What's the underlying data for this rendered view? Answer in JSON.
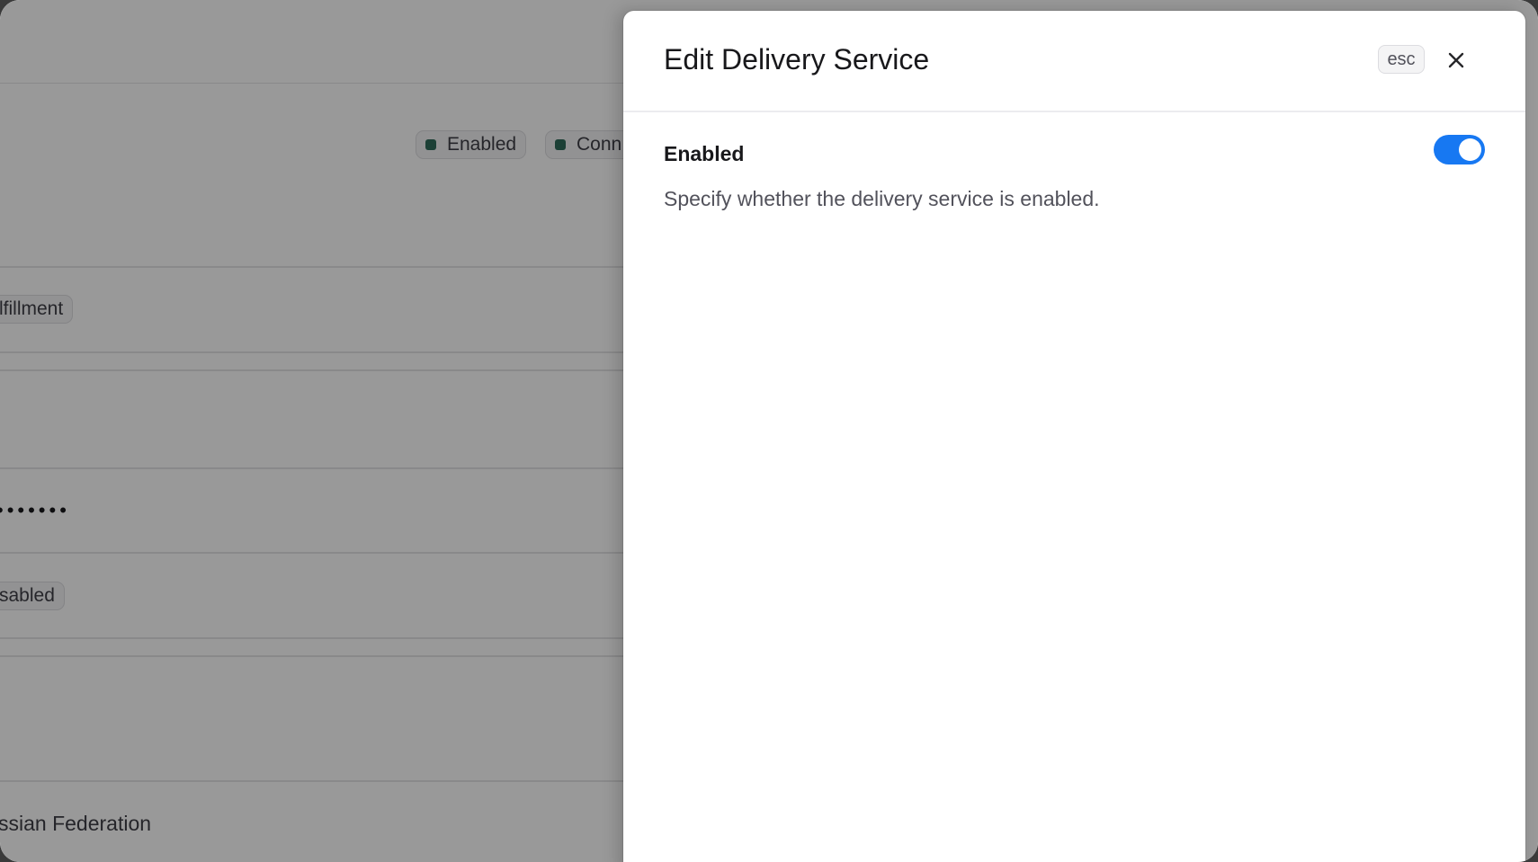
{
  "background": {
    "badges": [
      "Enabled",
      "Conn"
    ],
    "row_texts": [
      "lfillment",
      "sabled",
      "ssian Federation"
    ],
    "masked_value": "•••••••"
  },
  "drawer": {
    "title": "Edit Delivery Service",
    "esc_label": "esc",
    "close_icon": "close-icon",
    "field": {
      "label": "Enabled",
      "description": "Specify whether the delivery service is enabled.",
      "enabled": true
    }
  },
  "colors": {
    "accent": "#1778f2",
    "badge_dot": "#2f6b5b"
  }
}
